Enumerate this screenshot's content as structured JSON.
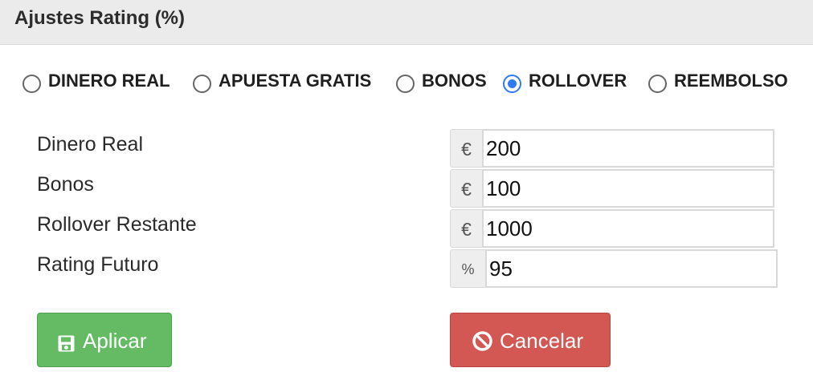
{
  "panel": {
    "title": "Ajustes Rating (%)"
  },
  "options": [
    {
      "label": "DINERO REAL",
      "selected": false
    },
    {
      "label": "APUESTA GRATIS",
      "selected": false
    },
    {
      "label": "BONOS",
      "selected": false
    },
    {
      "label": "ROLLOVER",
      "selected": true
    },
    {
      "label": "REEMBOLSO",
      "selected": false
    }
  ],
  "fields": [
    {
      "label": "Dinero Real",
      "addon": "€",
      "value": "200"
    },
    {
      "label": "Bonos",
      "addon": "€",
      "value": "100"
    },
    {
      "label": "Rollover Restante",
      "addon": "€",
      "value": "1000"
    },
    {
      "label": "Rating Futuro",
      "addon": "%",
      "value": "95"
    }
  ],
  "buttons": {
    "apply": {
      "label": "Aplicar",
      "icon": "floppy-disk-icon",
      "color": "#65bb64"
    },
    "cancel": {
      "label": "Cancelar",
      "icon": "ban-icon",
      "color": "#d35752"
    }
  },
  "colors": {
    "header_bg": "#ebebeb",
    "selected_radio": "#2f7bf3"
  }
}
